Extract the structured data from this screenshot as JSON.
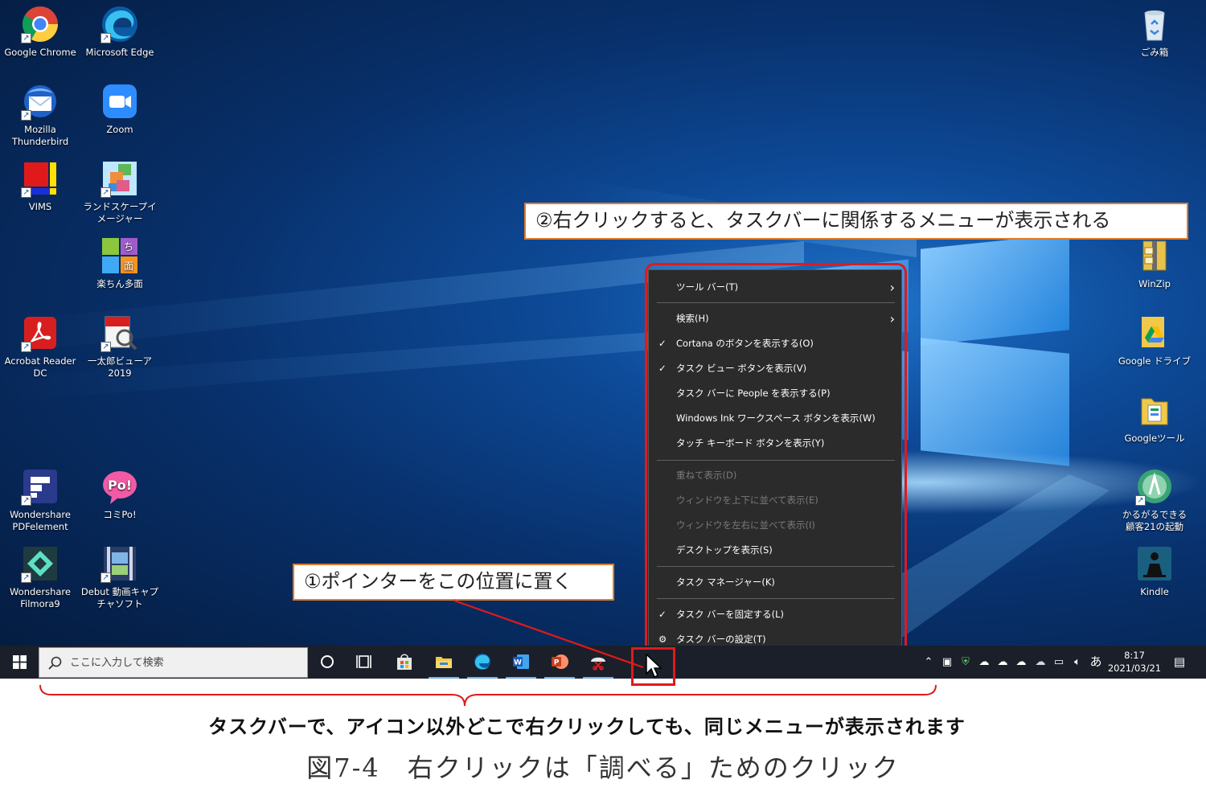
{
  "desktop": {
    "icons_left": [
      {
        "label": "Google Chrome",
        "icon": "chrome-icon"
      },
      {
        "label": "Microsoft Edge",
        "icon": "edge-icon"
      },
      {
        "label": "Mozilla Thunderbird",
        "icon": "thunderbird-icon"
      },
      {
        "label": "Zoom",
        "icon": "zoom-icon"
      },
      {
        "label": "VIMS",
        "icon": "vims-icon"
      },
      {
        "label": "ランドスケープイメージャー",
        "icon": "landscape-imager-icon"
      },
      {
        "label": "楽ちん多面",
        "icon": "rakuchin-tamen-icon"
      },
      {
        "label": "Acrobat Reader DC",
        "icon": "acrobat-icon"
      },
      {
        "label": "一太郎ビューア2019",
        "icon": "ichitaro-viewer-icon"
      },
      {
        "label": "Wondershare PDFelement",
        "icon": "pdfelement-icon"
      },
      {
        "label": "コミPo!",
        "icon": "comipo-icon"
      },
      {
        "label": "Wondershare Filmora9",
        "icon": "filmora-icon"
      },
      {
        "label": "Debut 動画キャプチャソフト",
        "icon": "debut-icon"
      }
    ],
    "icons_right": [
      {
        "label": "ごみ箱",
        "icon": "recycle-bin-icon"
      },
      {
        "label": "WinZip",
        "icon": "winzip-icon"
      },
      {
        "label": "Google ドライブ",
        "icon": "google-drive-icon"
      },
      {
        "label": "Googleツール",
        "icon": "google-tools-icon"
      },
      {
        "label": "かるがるできる顧客21の起動",
        "icon": "karugaru-icon"
      },
      {
        "label": "Kindle",
        "icon": "kindle-icon"
      }
    ]
  },
  "callouts": {
    "menu_note": "②右クリックすると、タスクバーに関係するメニューが表示される",
    "pointer_note": "①ポインターをこの位置に置く"
  },
  "context_menu": {
    "items": [
      {
        "label": "ツール バー(T)",
        "checked": false,
        "disabled": false,
        "submenu": true
      },
      {
        "label": "検索(H)",
        "checked": false,
        "disabled": false,
        "submenu": true
      },
      {
        "label": "Cortana のボタンを表示する(O)",
        "checked": true,
        "disabled": false
      },
      {
        "label": "タスク ビュー ボタンを表示(V)",
        "checked": true,
        "disabled": false
      },
      {
        "label": "タスク バーに People を表示する(P)",
        "checked": false,
        "disabled": false
      },
      {
        "label": "Windows Ink ワークスペース ボタンを表示(W)",
        "checked": false,
        "disabled": false
      },
      {
        "label": "タッチ キーボード ボタンを表示(Y)",
        "checked": false,
        "disabled": false
      },
      {
        "label": "重ねて表示(D)",
        "checked": false,
        "disabled": true
      },
      {
        "label": "ウィンドウを上下に並べて表示(E)",
        "checked": false,
        "disabled": true
      },
      {
        "label": "ウィンドウを左右に並べて表示(I)",
        "checked": false,
        "disabled": true
      },
      {
        "label": "デスクトップを表示(S)",
        "checked": false,
        "disabled": false
      },
      {
        "label": "タスク マネージャー(K)",
        "checked": false,
        "disabled": false
      },
      {
        "label": "タスク バーを固定する(L)",
        "checked": true,
        "disabled": false
      },
      {
        "label": "タスク バーの設定(T)",
        "checked": false,
        "disabled": false,
        "icon": "gear-icon"
      }
    ]
  },
  "taskbar": {
    "search_placeholder": "ここに入力して検索",
    "pinned": [
      "cortana-icon",
      "task-view-icon",
      "store-icon",
      "file-explorer-icon",
      "edge-icon",
      "word-icon",
      "powerpoint-icon",
      "snipping-icon"
    ],
    "ime": "あ",
    "time": "8:17",
    "date": "2021/03/21"
  },
  "captions": {
    "line1": "タスクバーで、アイコン以外どこで右クリックしても、同じメニューが表示されます",
    "line2": "図7-4　右クリックは「調べる」ためのクリック"
  },
  "colors": {
    "annotation_red": "#e01a1a",
    "callout_border": "#e07b2a",
    "menu_bg": "#2b2b2b",
    "taskbar_bg": "#1b1f29"
  }
}
